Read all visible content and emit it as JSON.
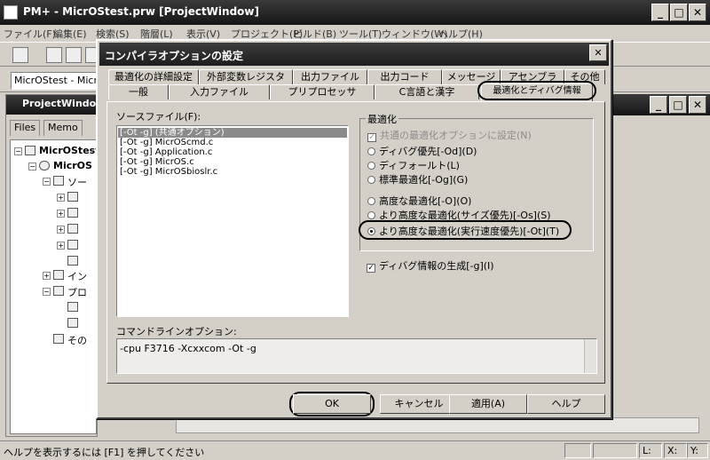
{
  "app": {
    "title": "PM+ - MicrOStest.prw [ProjectWindow]",
    "menu": [
      "ファイル(F)",
      "編集(E)",
      "検索(S)",
      "階層(L)",
      "表示(V)",
      "プロジェクト(P)",
      "ビルド(B)",
      "ツール(T)",
      "ウィンドウ(W)",
      "ヘルプ(H)"
    ],
    "project_combo": "MicrOStest - MicrO"
  },
  "project_window": {
    "title": "ProjectWindo",
    "tabs": [
      "Files",
      "Memo"
    ],
    "tree": [
      "MicrOStest",
      "MicrOS",
      "ソー",
      "イン",
      "プロ",
      "その"
    ]
  },
  "status_bar": {
    "help_text": "ヘルプを表示するには [F1] を押してください",
    "line_label": "L:",
    "col_label": "X:",
    "y_label": "Y:"
  },
  "dialog": {
    "title": "コンパイラオプションの設定",
    "tabs_row1": [
      "最適化の詳細設定",
      "外部変数レジスタ",
      "出力ファイル",
      "出力コード",
      "メッセージ",
      "アセンブラ",
      "その他"
    ],
    "tabs_row2": [
      "一般",
      "入力ファイル",
      "プリプロセッサ",
      "C言語と漢字",
      "最適化とディバグ情報"
    ],
    "source_files_label": "ソースファイル(F):",
    "source_files": [
      "[-Ot -g] (共通オプション)",
      "[-Ot -g] MicrOScmd.c",
      "[-Ot -g] Application.c",
      "[-Ot -g] MicrOS.c",
      "[-Ot -g] MicrOSbioslr.c"
    ],
    "optimization": {
      "group_label": "最適化",
      "common_checkbox": "共通の最適化オプションに設定(N)",
      "options": [
        "ディバグ優先[-Od](D)",
        "ディフォールト(L)",
        "標準最適化[-Og](G)",
        "高度な最適化[-O](O)",
        "より高度な最適化(サイズ優先)[-Os](S)",
        "より高度な最適化(実行速度優先)[-Ot](T)"
      ],
      "selected_index": 5
    },
    "debug_checkbox": "ディバグ情報の生成[-g](I)",
    "cmdline_label": "コマンドラインオプション:",
    "cmdline_value": "-cpu F3716 -Xcxxcom -Ot -g",
    "buttons": {
      "ok": "OK",
      "cancel": "キャンセル",
      "apply": "適用(A)",
      "help": "ヘルプ"
    }
  }
}
